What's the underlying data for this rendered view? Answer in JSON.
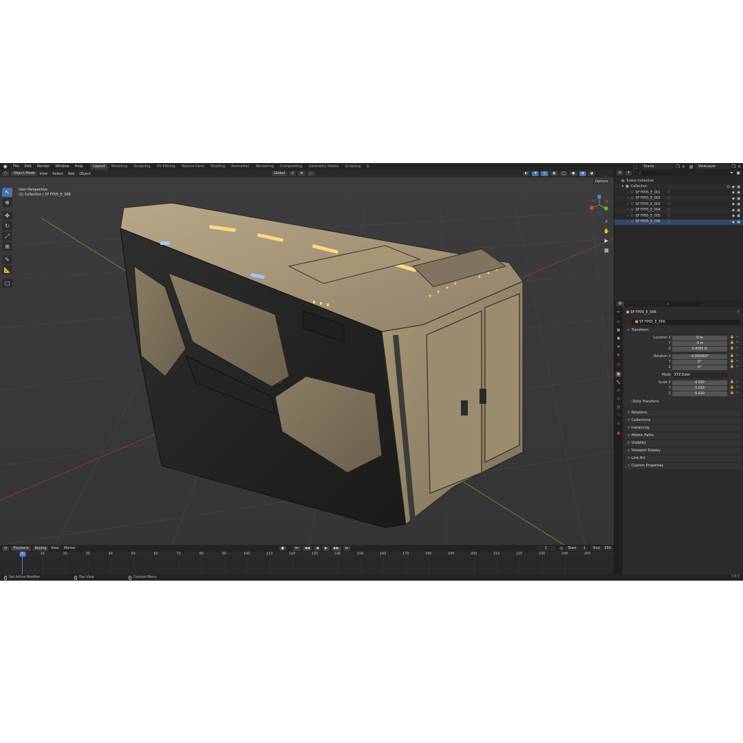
{
  "menu": [
    "File",
    "Edit",
    "Render",
    "Window",
    "Help"
  ],
  "workspaces": [
    {
      "label": "Layout",
      "active": true
    },
    {
      "label": "Modeling"
    },
    {
      "label": "Sculpting"
    },
    {
      "label": "UV Editing"
    },
    {
      "label": "Texture Paint"
    },
    {
      "label": "Shading"
    },
    {
      "label": "Animation"
    },
    {
      "label": "Rendering"
    },
    {
      "label": "Compositing"
    },
    {
      "label": "Geometry Nodes"
    },
    {
      "label": "Scripting"
    }
  ],
  "scene_name": "Scene",
  "view_layer": "ViewLayer",
  "viewport": {
    "mode": "Object Mode",
    "menus": [
      "View",
      "Select",
      "Add",
      "Object"
    ],
    "orientation": "Global",
    "options_label": "Options",
    "perspective": "User Perspective",
    "context": "(1) Collection | SF FP05_E_006"
  },
  "timeline": {
    "menus": [
      "Playback",
      "Keying",
      "View",
      "Marker"
    ],
    "current_frame": "1",
    "start_label": "Start",
    "start": "1",
    "end_label": "End",
    "end": "250",
    "ticks": [
      "10",
      "20",
      "30",
      "40",
      "50",
      "60",
      "70",
      "80",
      "90",
      "100",
      "110",
      "120",
      "130",
      "140",
      "150",
      "160",
      "170",
      "180",
      "190",
      "200",
      "210",
      "220",
      "230",
      "240",
      "250"
    ]
  },
  "status": {
    "left": "Set Active Modifier",
    "middle": "Pan View",
    "right": "Context Menu",
    "version": "3.6.0"
  },
  "outliner": {
    "scene_collection": "Scene Collection",
    "collection": "Collection",
    "objects": [
      "SF FP05_E_001",
      "SF FP05_E_002",
      "SF FP05_E_003",
      "SF FP05_E_004",
      "SF FP05_E_005",
      "SF FP05_E_006"
    ]
  },
  "properties": {
    "object_name": "SF FP05_E_006",
    "object_field": "SF FP05_E_006",
    "transform_label": "Transform",
    "location": {
      "label": "Location X",
      "x": "0 m",
      "y": "-0 m",
      "z": "1.4595 m"
    },
    "rotation": {
      "label": "Rotation X",
      "x": "-0.000003°",
      "y": "0°",
      "z": "0°"
    },
    "mode_label": "Mode",
    "mode": "XYZ Euler",
    "scale": {
      "label": "Scale X",
      "x": "0.010",
      "y": "0.010",
      "z": "0.010"
    },
    "axis_y": "Y",
    "axis_z": "Z",
    "delta": "Delta Transform",
    "panels": [
      "Relations",
      "Collections",
      "Instancing",
      "Motion Paths",
      "Visibility",
      "Viewport Display",
      "Line Art",
      "Custom Properties"
    ]
  },
  "colors": {
    "accent": "#4772b3",
    "object_icon": "#f0a347",
    "mesh_icon": "#65c45a",
    "playhead": "#4b86d6"
  }
}
